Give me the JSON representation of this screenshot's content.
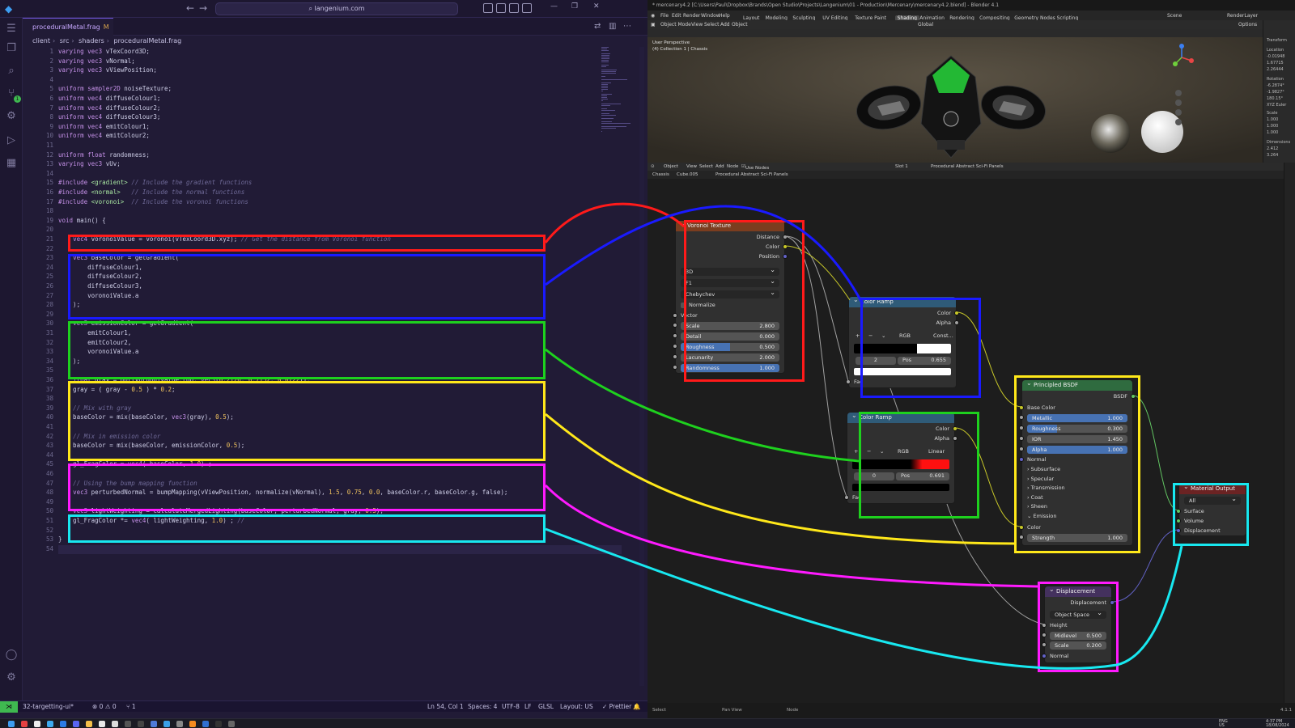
{
  "vscode": {
    "search": "langenium.com",
    "tab": {
      "name": "proceduralMetal.frag",
      "modified": "M"
    },
    "breadcrumb": [
      "client",
      "src",
      "shaders",
      "proceduralMetal.frag"
    ],
    "lines": [
      "varying vec3 vTexCoord3D;",
      "varying vec3 vNormal;",
      "varying vec3 vViewPosition;",
      "",
      "uniform sampler2D noiseTexture;",
      "uniform vec4 diffuseColour1;",
      "uniform vec4 diffuseColour2;",
      "uniform vec4 diffuseColour3;",
      "uniform vec4 emitColour1;",
      "uniform vec4 emitColour2;",
      "",
      "uniform float randomness;",
      "varying vec3 vUv;",
      "",
      "#include <gradient> // Include the gradient functions",
      "#include <normal>   // Include the normal functions",
      "#include <voronoi>  // Include the voronoi functions",
      "",
      "void main() {",
      "",
      "    vec4 voronoiValue = voronoi(vTexCoord3D.xyz); // Get the distance from Voronoi function",
      "",
      "    vec3 baseColor = getGradient(",
      "        diffuseColour1,",
      "        diffuseColour2,",
      "        diffuseColour3,",
      "        voronoiValue.a",
      "    );",
      "",
      "    vec3 emissionColor = getGradient(",
      "        emitColour1,",
      "        emitColour2,",
      "        voronoiValue.a",
      "    );",
      "",
      "    float gray = dot(voronoiValue.rgb, vec3(0.2126, 0.7152, 0.0722));",
      "    gray = ( gray - 0.5 ) * 0.2;",
      "",
      "    // Mix with gray",
      "    baseColor = mix(baseColor, vec3(gray), 0.5);",
      "",
      "    // Mix in emission color",
      "    baseColor = mix(baseColor, emissionColor, 0.5);",
      "",
      "    gl_FragColor = vec4( baseColor, 1.0) ;",
      "",
      "    // Using the bump mapping function",
      "    vec3 perturbedNormal = bumpMapping(vViewPosition, normalize(vNormal), 1.5, 0.75, 0.0, baseColor.r, baseColor.g, false);",
      "",
      "    vec3 lightWeighting = calculateMergedLighting(baseColor, perturbedNormal, gray, 0.5);",
      "    gl_FragColor *= vec4( lightWeighting, 1.0) ; //",
      "",
      "}",
      ""
    ],
    "status": {
      "branch": "32-targetting-ui*",
      "problems": "⊗ 0 ⚠ 0",
      "ports": "⑂ 1",
      "position": "Ln 54, Col 1",
      "spaces": "Spaces: 4",
      "encoding": "UTF-8",
      "eol": "LF",
      "language": "GLSL",
      "layout": "Layout: US",
      "prettier": "✓ Prettier"
    }
  },
  "blender": {
    "title": "* mercenary4.2 [C:\\Users\\Paul\\Dropbox\\Brands\\Open Studio\\Projects\\Langenium\\01 - Production\\Mercenary\\mercenary4.2.blend] - Blender 4.1",
    "menu": [
      "File",
      "Edit",
      "Render",
      "Window",
      "Help"
    ],
    "workspaces": [
      "Layout",
      "Modeling",
      "Sculpting",
      "UV Editing",
      "Texture Paint",
      "Shading",
      "Animation",
      "Rendering",
      "Compositing",
      "Geometry Nodes",
      "Scripting"
    ],
    "active_workspace": "Shading",
    "scene": "Scene",
    "view_layer": "RenderLayer",
    "viewport": {
      "mode": "Object Mode",
      "menu": [
        "View",
        "Select",
        "Add",
        "Object"
      ],
      "orientation": "Global",
      "options": "Options",
      "info1": "User Perspective",
      "info2": "(4) Collection 1 | Chassis"
    },
    "npanel": {
      "header": "Transform",
      "location": "Location",
      "loc": [
        "-0.01948",
        "1.67715",
        "2.26444"
      ],
      "rotation": "Rotation",
      "rot": [
        "-6.2874°",
        "-1.9827°",
        "180.15°"
      ],
      "rot_mode": "XYZ Euler",
      "scale": "Scale",
      "sca": [
        "1.000",
        "1.000",
        "1.000"
      ],
      "dimensions": "Dimensions",
      "dim": [
        "2.412",
        "3.264"
      ],
      "axes": [
        "X",
        "Y",
        "Z"
      ]
    },
    "node_editor": {
      "mode": "Object",
      "menu": [
        "View",
        "Select",
        "Add",
        "Node"
      ],
      "use_nodes": "Use Nodes",
      "slot": "Slot 1",
      "material": "Procedural Abstract Sci-Fi Panels",
      "breadcrumb": [
        "Chassis",
        "Cube.005",
        "Procedural Abstract Sci-Fi Panels"
      ]
    },
    "nodes": {
      "voronoi": {
        "title": "Voronoi Texture",
        "outputs": [
          "Distance",
          "Color",
          "Position"
        ],
        "dim": "3D",
        "feature": "F1",
        "metric": "Chebychev",
        "normalize": "Normalize",
        "vector": "Vector",
        "fields": [
          {
            "label": "Scale",
            "value": "2.800",
            "frac": 0
          },
          {
            "label": "Detail",
            "value": "0.000",
            "frac": 0
          },
          {
            "label": "Roughness",
            "value": "0.500",
            "frac": 0.5
          },
          {
            "label": "Lacunarity",
            "value": "2.000",
            "frac": 0
          },
          {
            "label": "Randomness",
            "value": "1.000",
            "frac": 1
          }
        ]
      },
      "ramp1": {
        "title": "Color Ramp",
        "outputs": [
          "Color",
          "Alpha"
        ],
        "mode": "RGB",
        "interp": "Const...",
        "index": "2",
        "pos_label": "Pos",
        "pos": "0.655",
        "fac": "Fac",
        "plus": "+",
        "minus": "−"
      },
      "ramp2": {
        "title": "Color Ramp",
        "outputs": [
          "Color",
          "Alpha"
        ],
        "mode": "RGB",
        "interp": "Linear",
        "index": "0",
        "pos_label": "Pos",
        "pos": "0.691",
        "fac": "Fac",
        "plus": "+",
        "minus": "−"
      },
      "bsdf": {
        "title": "Principled BSDF",
        "output": "BSDF",
        "base_color": "Base Color",
        "fields": [
          {
            "label": "Metallic",
            "value": "1.000",
            "frac": 1
          },
          {
            "label": "Roughness",
            "value": "0.300",
            "frac": 0.3
          },
          {
            "label": "IOR",
            "value": "1.450",
            "frac": 0
          },
          {
            "label": "Alpha",
            "value": "1.000",
            "frac": 1
          }
        ],
        "normal": "Normal",
        "panels": [
          "Subsurface",
          "Specular",
          "Transmission",
          "Coat",
          "Sheen"
        ],
        "emission": "Emission",
        "color": "Color",
        "strength_label": "Strength",
        "strength": "1.000"
      },
      "output": {
        "title": "Material Output",
        "target": "All",
        "inputs": [
          "Surface",
          "Volume",
          "Displacement"
        ]
      },
      "displacement": {
        "title": "Displacement",
        "output": "Displacement",
        "space": "Object Space",
        "height": "Height",
        "midlevel_label": "Midlevel",
        "midlevel": "0.500",
        "scale_label": "Scale",
        "scale": "0.200",
        "normal": "Normal"
      }
    },
    "status": [
      "Select",
      "Pan View",
      "Node"
    ],
    "version": "4.1.1"
  },
  "taskbar": {
    "lang": "ENG",
    "region": "US",
    "time": "4:37 PM",
    "date": "18/08/2024"
  },
  "colors": {
    "red": "#ff1a1a",
    "blue": "#1a1aff",
    "green": "#1ed11e",
    "yellow": "#ffe81a",
    "magenta": "#ff1aff",
    "cyan": "#18e8f0"
  }
}
